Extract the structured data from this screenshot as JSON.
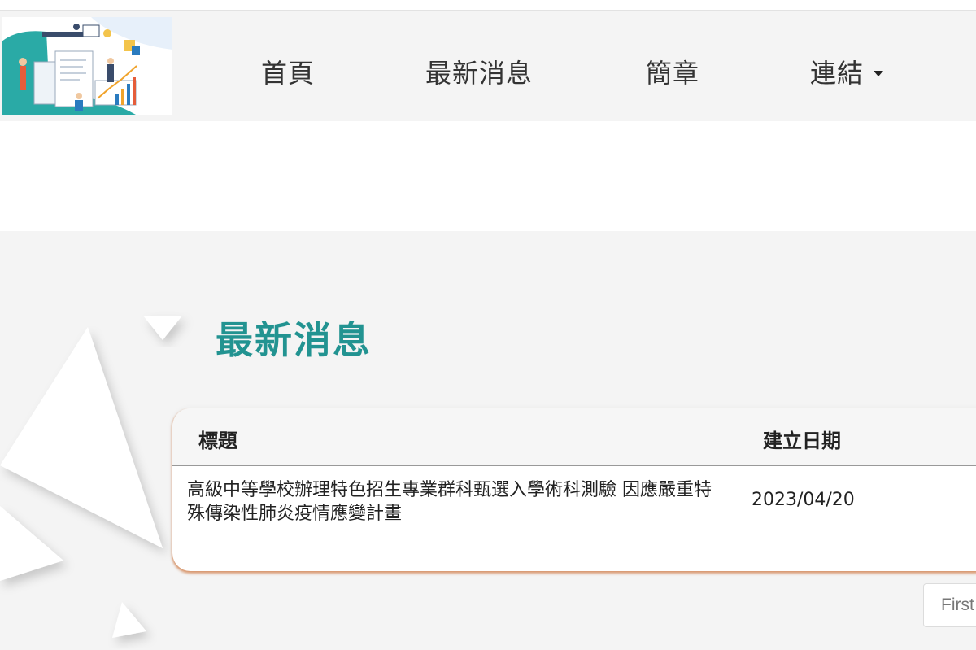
{
  "nav": {
    "home": "首頁",
    "news": "最新消息",
    "brochure": "簡章",
    "links": "連結"
  },
  "news_section": {
    "title": "最新消息",
    "columns": {
      "title": "標題",
      "date": "建立日期"
    },
    "rows": [
      {
        "title": "高級中等學校辦理特色招生專業群科甄選入學術科測驗 因應嚴重特殊傳染性肺炎疫情應變計畫",
        "date": "2023/04/20"
      }
    ]
  },
  "pagination": {
    "first": "First"
  },
  "colors": {
    "accent": "#229391",
    "card_shadow": "#d68a5a",
    "nav_bg": "#f4f4f4"
  }
}
